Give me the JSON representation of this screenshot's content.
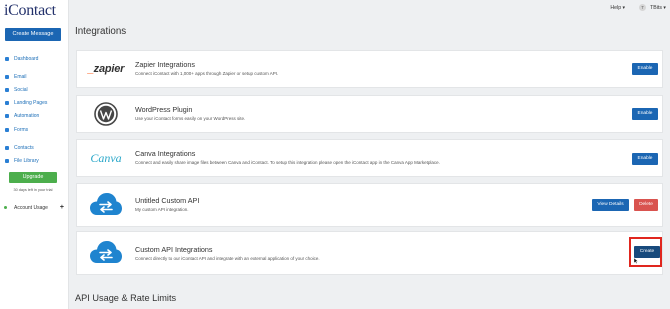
{
  "app": {
    "logo_text": "iContact"
  },
  "sidebar": {
    "create_message": "Create Message",
    "items": [
      {
        "label": "Dashboard"
      },
      {
        "label": "Email"
      },
      {
        "label": "Social"
      },
      {
        "label": "Landing Pages"
      },
      {
        "label": "Automation"
      },
      {
        "label": "Forms"
      },
      {
        "label": "Contacts"
      },
      {
        "label": "File Library"
      }
    ],
    "upgrade": "Upgrade",
    "trial_text": "30 days left in your trial",
    "account_usage": "Account Usage",
    "account_usage_plus": "+"
  },
  "topbar": {
    "help": "Help ▾",
    "avatar_initial": "T",
    "user": "TBits ▾"
  },
  "page": {
    "title": "Integrations",
    "section_title": "API Usage & Rate Limits"
  },
  "integrations": [
    {
      "logo": "zapier",
      "title": "Zapier Integrations",
      "desc": "Connect iContact with 1,000+ apps through Zapier or setup custom API.",
      "button": "Enable"
    },
    {
      "logo": "wordpress",
      "title": "WordPress Plugin",
      "desc": "Use your iContact forms easily on your WordPress site.",
      "button": "Enable"
    },
    {
      "logo": "canva",
      "title": "Canva Integrations",
      "desc": "Connect and easily share image files between Canva and iContact. To setup this integration please open the iContact app in the Canva App Marketplace.",
      "button": "Enable"
    },
    {
      "logo": "api-cloud",
      "title": "Untitled Custom API",
      "desc": "My custom API integration.",
      "button": "View Details",
      "button2": "Delete"
    },
    {
      "logo": "api-cloud",
      "title": "Custom API Integrations",
      "desc": "Connect directly to our iContact API and integrate with an external application of your choice.",
      "button": "Create"
    }
  ],
  "logos": {
    "zapier_prefix": "_",
    "zapier_text": "zapier",
    "canva_text": "Canva"
  },
  "colors": {
    "primary": "#1b66b3",
    "danger": "#d9534f",
    "success": "#4cae4c",
    "highlight": "#e0261e"
  }
}
